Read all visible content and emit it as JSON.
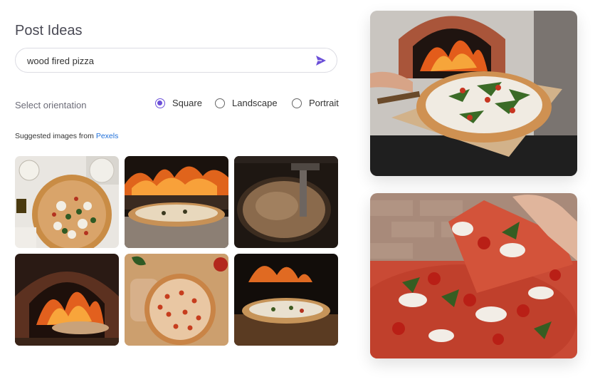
{
  "page": {
    "title": "Post Ideas"
  },
  "search": {
    "value": "wood fired pizza",
    "send_icon": "send-icon"
  },
  "orientation": {
    "label": "Select orientation",
    "options": [
      "Square",
      "Landscape",
      "Portrait"
    ],
    "selected": "Square"
  },
  "suggested": {
    "prefix": "Suggested images from ",
    "source": "Pexels"
  },
  "colors": {
    "accent": "#6b4fd8",
    "link": "#1e6fd9"
  }
}
